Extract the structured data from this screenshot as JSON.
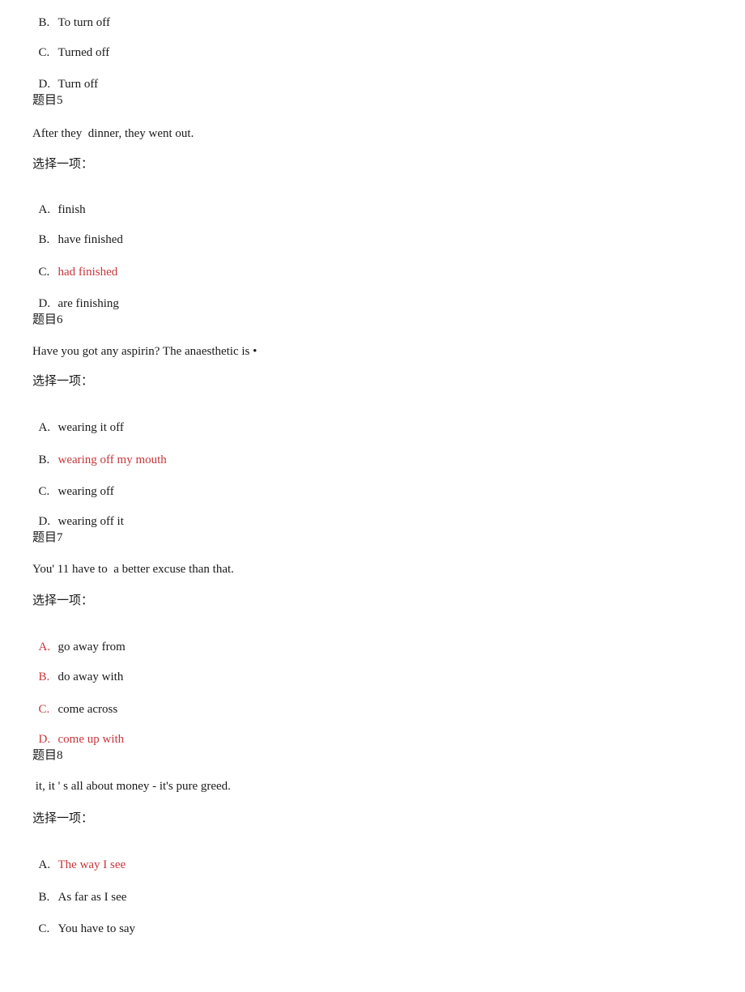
{
  "colors": {
    "text": "#1a1a1a",
    "highlight": "#c8373b"
  },
  "prompt_label": "选择一项：",
  "q4_tail": {
    "options": [
      {
        "letter": "B.",
        "text": "To turn off",
        "label_red": false,
        "text_red": false
      },
      {
        "letter": "C.",
        "text": "Turned off",
        "label_red": false,
        "text_red": false
      },
      {
        "letter": "D.",
        "text": "Turn off",
        "label_red": false,
        "text_red": false
      }
    ]
  },
  "q5": {
    "heading": "题目5",
    "stem": "After they  dinner, they went out.",
    "options": [
      {
        "letter": "A.",
        "text": "finish",
        "label_red": false,
        "text_red": false
      },
      {
        "letter": "B.",
        "text": "have finished",
        "label_red": false,
        "text_red": false
      },
      {
        "letter": "C.",
        "text": "had finished",
        "label_red": false,
        "text_red": true
      },
      {
        "letter": "D.",
        "text": "are finishing",
        "label_red": false,
        "text_red": false
      }
    ]
  },
  "q6": {
    "heading": "题目6",
    "stem": "Have you got any aspirin? The anaesthetic is •",
    "options": [
      {
        "letter": "A.",
        "text": "wearing it off",
        "label_red": false,
        "text_red": false
      },
      {
        "letter": "B.",
        "text": "wearing off my mouth",
        "label_red": false,
        "text_red": true
      },
      {
        "letter": "C.",
        "text": "wearing off",
        "label_red": false,
        "text_red": false
      },
      {
        "letter": "D.",
        "text": "wearing off it",
        "label_red": false,
        "text_red": false
      }
    ]
  },
  "q7": {
    "heading": "题目7",
    "stem": "You' 11 have to  a better excuse than that.",
    "options": [
      {
        "letter": "A.",
        "text": "go away from",
        "label_red": true,
        "text_red": false
      },
      {
        "letter": "B.",
        "text": "do away with",
        "label_red": true,
        "text_red": false
      },
      {
        "letter": "C.",
        "text": "come across",
        "label_red": true,
        "text_red": false
      },
      {
        "letter": "D.",
        "text": "come up with",
        "label_red": true,
        "text_red": true
      }
    ]
  },
  "q8": {
    "heading": "题目8",
    "stem": " it, it ' s all about money - it's pure greed.",
    "options": [
      {
        "letter": "A.",
        "text": "The way I see",
        "label_red": false,
        "text_red": true
      },
      {
        "letter": "B.",
        "text": "As far as I see",
        "label_red": false,
        "text_red": false
      },
      {
        "letter": "C.",
        "text": "You have to say",
        "label_red": false,
        "text_red": false
      }
    ]
  }
}
